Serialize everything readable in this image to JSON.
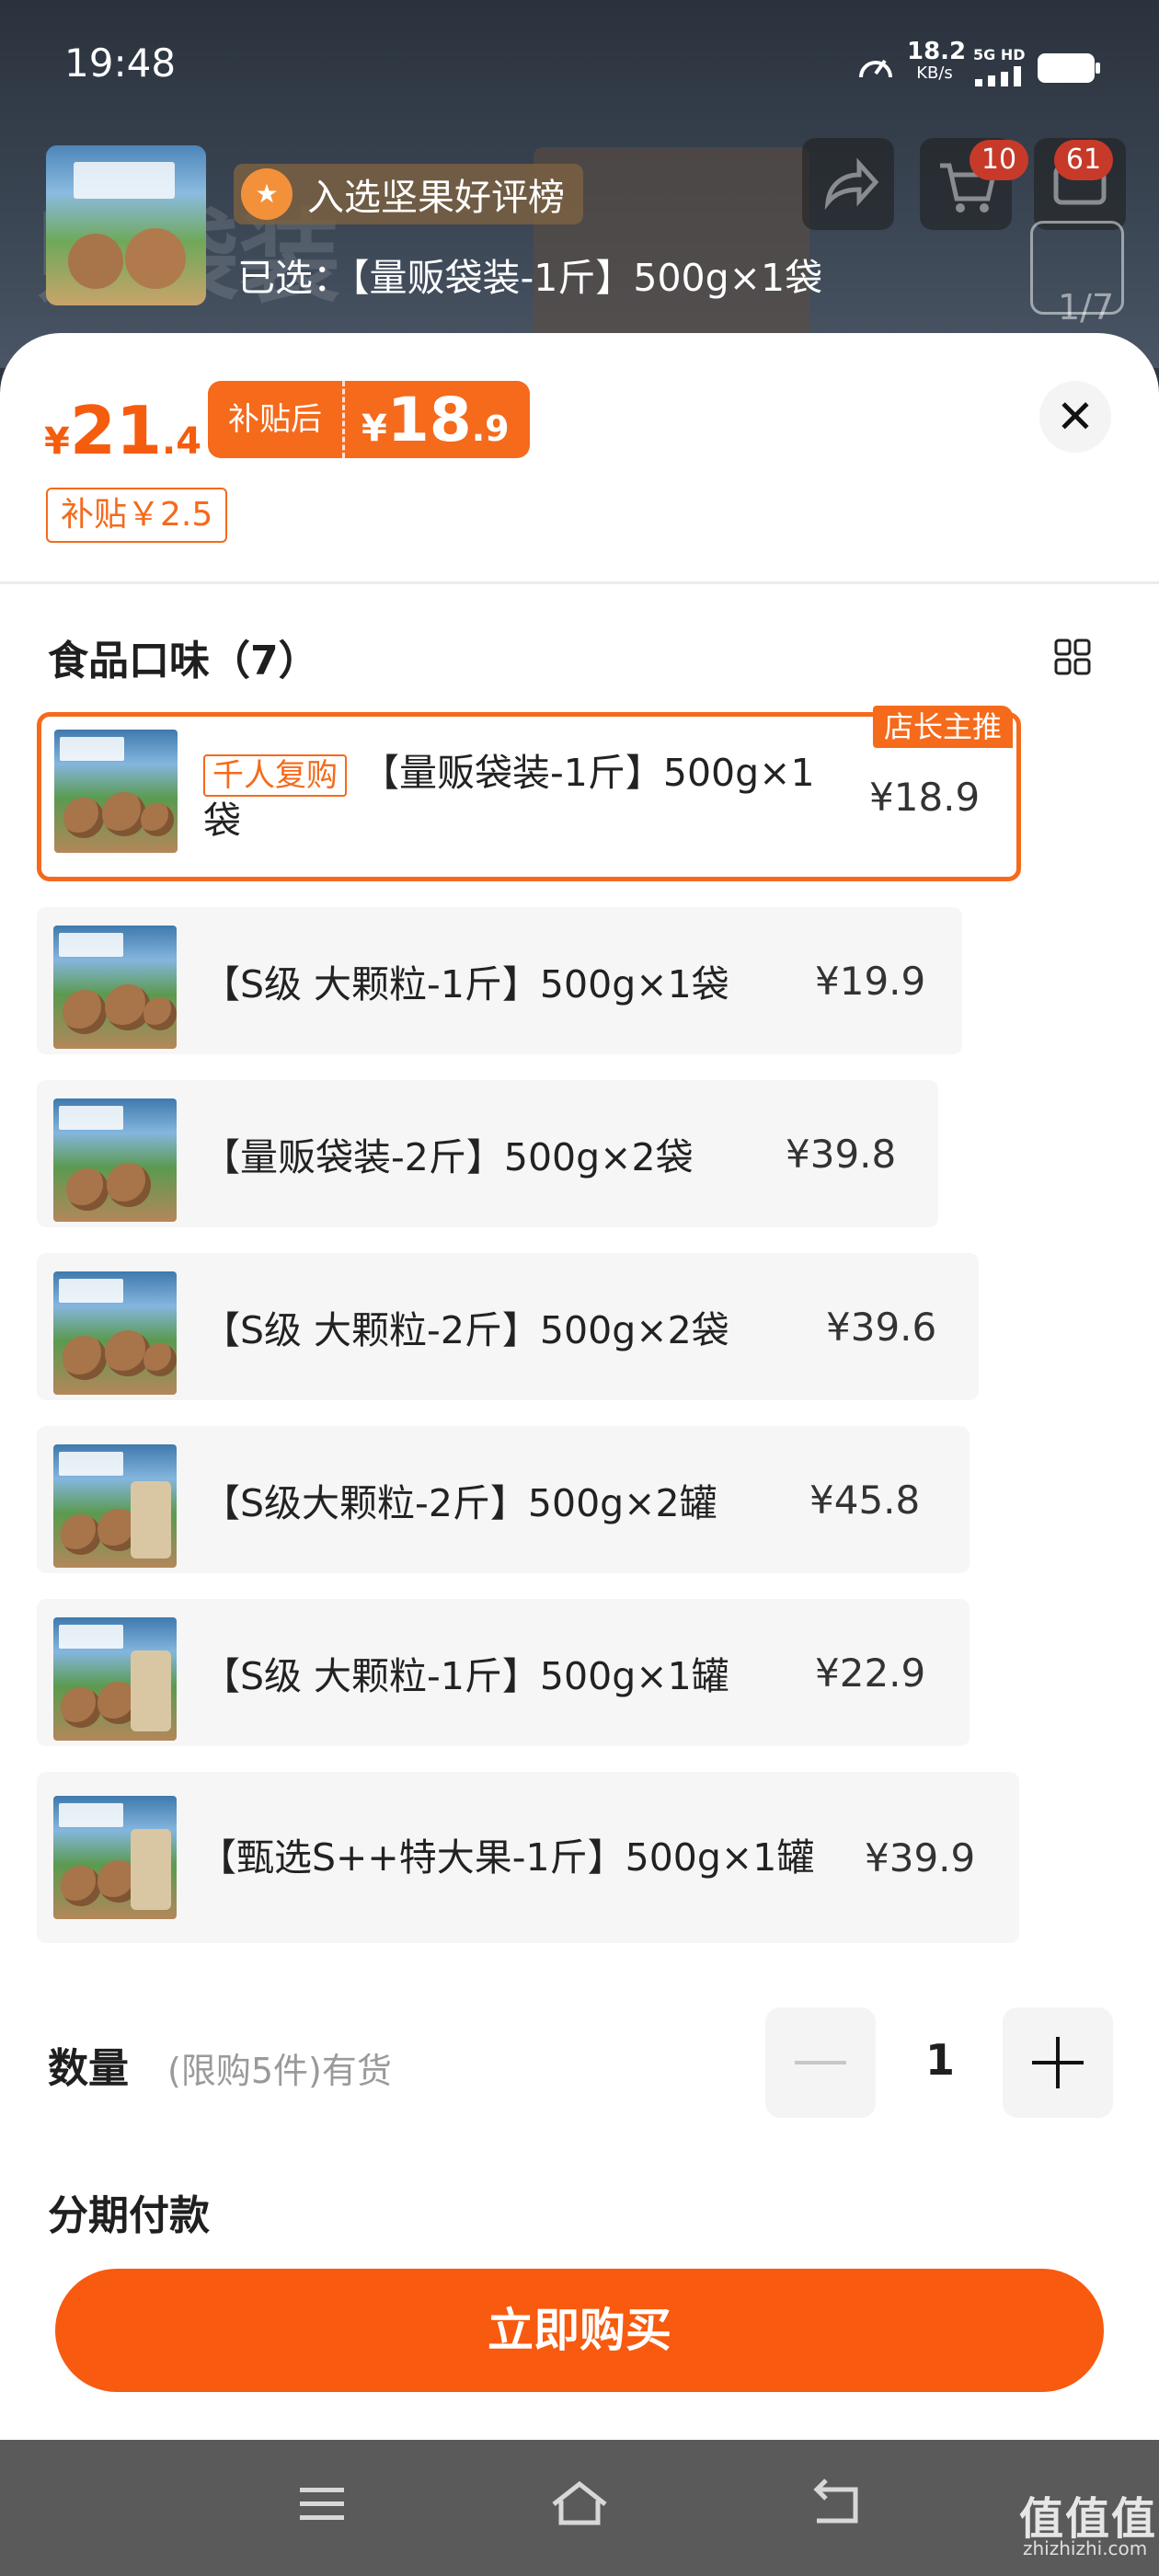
{
  "status_bar": {
    "time": "19:48",
    "net_speed_value": "18.2",
    "net_speed_unit": "KB/s",
    "network": "5G HD"
  },
  "background_page": {
    "cart_count": "10",
    "message_count": "61",
    "image_counter": "1/7"
  },
  "header": {
    "award_text": "入选坚果好评榜",
    "selected_text": "已选：【量贩袋装-1斤】500g×1袋"
  },
  "price": {
    "currency": "¥",
    "original_int": "21",
    "original_dec": ".4",
    "after_subsidy_label": "补贴后",
    "after_subsidy_int": "18",
    "after_subsidy_dec": ".9",
    "subsidy_tag": "补贴￥2.5"
  },
  "colors": {
    "accent": "#f56a1b",
    "buy_button": "#f85a0f",
    "price_text": "#f55c0e"
  },
  "section": {
    "title": "食品口味（7）"
  },
  "variants": [
    {
      "rebuy_tag": "千人复购",
      "name": "【量贩袋装-1斤】500g×1袋",
      "price": "¥18.9",
      "shop_tag": "店长主推",
      "selected": true
    },
    {
      "name": "【S级 大颗粒-1斤】500g×1袋",
      "price": "¥19.9"
    },
    {
      "name": "【量贩袋装-2斤】500g×2袋",
      "price": "¥39.8"
    },
    {
      "name": "【S级 大颗粒-2斤】500g×2袋",
      "price": "¥39.6"
    },
    {
      "name": "【S级大颗粒-2斤】500g×2罐",
      "price": "¥45.8"
    },
    {
      "name": "【S级 大颗粒-1斤】500g×1罐",
      "price": "¥22.9"
    },
    {
      "name": "【甄选S++特大果-1斤】500g×1罐",
      "price": "¥39.9"
    }
  ],
  "quantity": {
    "label": "数量",
    "sub": "(限购5件)有货",
    "value": "1"
  },
  "installment": {
    "label": "分期付款"
  },
  "buy_button": {
    "label": "立即购买"
  },
  "watermark": {
    "text": "值值值",
    "sub": "zhizhizhi.com"
  },
  "icons": [
    "speedometer-icon",
    "signal-icon",
    "battery-icon",
    "share-icon",
    "cart-icon",
    "message-icon",
    "award-medal-icon",
    "close-icon",
    "grid-view-icon",
    "minus-icon",
    "plus-icon",
    "menu-icon",
    "home-icon",
    "back-icon"
  ]
}
